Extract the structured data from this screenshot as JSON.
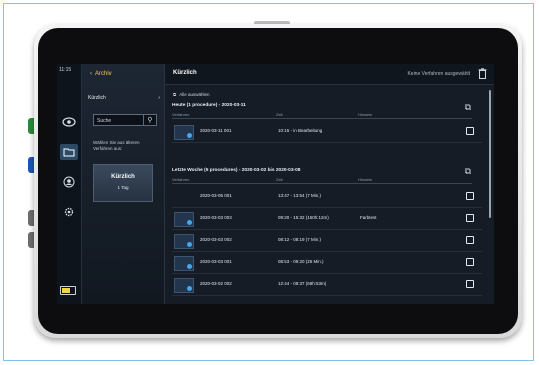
{
  "status": {
    "time": "11:15"
  },
  "nav": {
    "back_label": "Archiv"
  },
  "filter": {
    "row_label": "Kürzlich",
    "search_placeholder": "Suche",
    "hint": "Wählen Sie aus älteren Verfahren aus:",
    "recent_title": "Kürzlich",
    "recent_sub": "1 Tag"
  },
  "main": {
    "title": "Kürzlich",
    "selection_status": "Keine Verfahren ausgewählt",
    "select_all": "Alle auswählen",
    "columns": {
      "procedure": "Verfahren",
      "time": "Zeit",
      "note": "Hinweis"
    },
    "groups": [
      {
        "title": "Heute (1 procedure) - 2020-03-11",
        "rows": [
          {
            "id": "2020-03-11 001",
            "time": "10:15 - in Bearbeitung",
            "note": ""
          }
        ]
      },
      {
        "title": "Letzte Woche (5 procedures) - 2020-03-02 bis 2020-03-08",
        "rows": [
          {
            "id": "2020-03-05 001",
            "time": "13:47 - 13:54 (7 Min.)",
            "note": ""
          },
          {
            "id": "2020-03-03 003",
            "time": "09:20 - 15:32 (150h:12m)",
            "note": "Farbtest"
          },
          {
            "id": "2020-03-03 002",
            "time": "08:12 - 08:19 (7 Min.)",
            "note": ""
          },
          {
            "id": "2020-03-03 001",
            "time": "08:53 - 09:20 (26 Min.)",
            "note": ""
          },
          {
            "id": "2020-03-02 002",
            "time": "12:44 - 09:37 (68h:53m)",
            "note": ""
          }
        ]
      }
    ]
  },
  "icons": [
    "eye-icon",
    "folder-icon",
    "user-icon",
    "gear-icon",
    "battery-icon",
    "search-icon",
    "chevron-left-icon",
    "chevron-right-icon",
    "trash-icon",
    "copy-icon",
    "checkbox-icon"
  ],
  "colors": {
    "accent": "#f5c94c",
    "active_rail": "#2a4a66",
    "background": "#141b24"
  }
}
